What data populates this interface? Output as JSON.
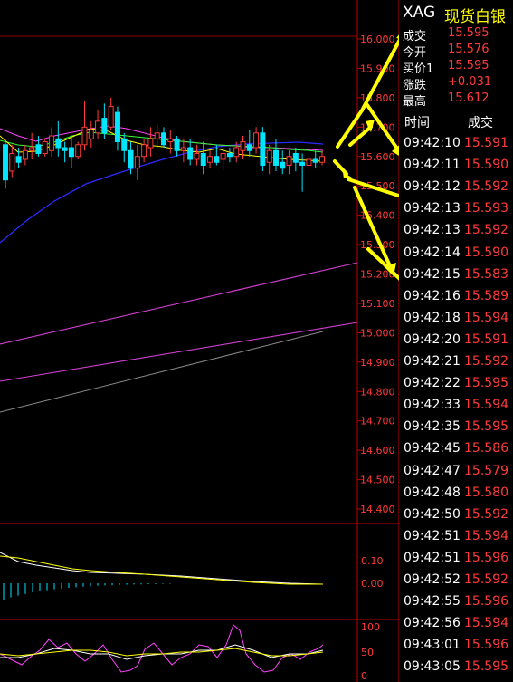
{
  "quote_header": {
    "symbol": "XAG",
    "name": "现货白银"
  },
  "quote_fields": [
    {
      "label": "成交",
      "value": "15.595"
    },
    {
      "label": "今开",
      "value": "15.576"
    },
    {
      "label": "买价1",
      "value": "15.595"
    },
    {
      "label": "涨跌",
      "value": "+0.031"
    },
    {
      "label": "最高",
      "value": "15.612"
    }
  ],
  "trade_table": {
    "headers": {
      "time": "时间",
      "price": "成交"
    },
    "rows": [
      {
        "time": "09:42:10",
        "price": "15.591"
      },
      {
        "time": "09:42:11",
        "price": "15.590"
      },
      {
        "time": "09:42:12",
        "price": "15.592"
      },
      {
        "time": "09:42:13",
        "price": "15.593"
      },
      {
        "time": "09:42:13",
        "price": "15.592"
      },
      {
        "time": "09:42:14",
        "price": "15.590"
      },
      {
        "time": "09:42:15",
        "price": "15.583"
      },
      {
        "time": "09:42:16",
        "price": "15.589"
      },
      {
        "time": "09:42:18",
        "price": "15.594"
      },
      {
        "time": "09:42:20",
        "price": "15.591"
      },
      {
        "time": "09:42:21",
        "price": "15.592"
      },
      {
        "time": "09:42:22",
        "price": "15.595"
      },
      {
        "time": "09:42:33",
        "price": "15.594"
      },
      {
        "time": "09:42:35",
        "price": "15.595"
      },
      {
        "time": "09:42:45",
        "price": "15.586"
      },
      {
        "time": "09:42:47",
        "price": "15.579"
      },
      {
        "time": "09:42:48",
        "price": "15.580"
      },
      {
        "time": "09:42:50",
        "price": "15.592"
      },
      {
        "time": "09:42:51",
        "price": "15.594"
      },
      {
        "time": "09:42:51",
        "price": "15.596"
      },
      {
        "time": "09:42:52",
        "price": "15.592"
      },
      {
        "time": "09:42:55",
        "price": "15.596"
      },
      {
        "time": "09:42:56",
        "price": "15.594"
      },
      {
        "time": "09:43:01",
        "price": "15.596"
      },
      {
        "time": "09:43:05",
        "price": "15.595"
      }
    ]
  },
  "chart_data": {
    "type": "candlestick",
    "price_axis": {
      "ylim": [
        14.35,
        16.05
      ],
      "ticks": [
        "16.000",
        "15.900",
        "15.800",
        "15.700",
        "15.600",
        "15.500",
        "15.400",
        "15.300",
        "15.200",
        "15.100",
        "15.000",
        "14.900",
        "14.800",
        "14.700",
        "14.600",
        "14.500",
        "14.400"
      ]
    },
    "candles": [
      {
        "o": 15.64,
        "h": 15.66,
        "l": 15.49,
        "c": 15.52
      },
      {
        "o": 15.55,
        "h": 15.64,
        "l": 15.53,
        "c": 15.61
      },
      {
        "o": 15.6,
        "h": 15.63,
        "l": 15.56,
        "c": 15.58
      },
      {
        "o": 15.59,
        "h": 15.64,
        "l": 15.57,
        "c": 15.62
      },
      {
        "o": 15.62,
        "h": 15.68,
        "l": 15.59,
        "c": 15.63
      },
      {
        "o": 15.64,
        "h": 15.67,
        "l": 15.6,
        "c": 15.61
      },
      {
        "o": 15.61,
        "h": 15.66,
        "l": 15.6,
        "c": 15.65
      },
      {
        "o": 15.62,
        "h": 15.7,
        "l": 15.6,
        "c": 15.67
      },
      {
        "o": 15.66,
        "h": 15.72,
        "l": 15.6,
        "c": 15.63
      },
      {
        "o": 15.63,
        "h": 15.65,
        "l": 15.58,
        "c": 15.62
      },
      {
        "o": 15.63,
        "h": 15.67,
        "l": 15.56,
        "c": 15.6
      },
      {
        "o": 15.6,
        "h": 15.65,
        "l": 15.59,
        "c": 15.64
      },
      {
        "o": 15.64,
        "h": 15.79,
        "l": 15.62,
        "c": 15.7
      },
      {
        "o": 15.66,
        "h": 15.72,
        "l": 15.63,
        "c": 15.69
      },
      {
        "o": 15.68,
        "h": 15.76,
        "l": 15.66,
        "c": 15.72
      },
      {
        "o": 15.73,
        "h": 15.78,
        "l": 15.66,
        "c": 15.68
      },
      {
        "o": 15.7,
        "h": 15.8,
        "l": 15.69,
        "c": 15.77
      },
      {
        "o": 15.75,
        "h": 15.77,
        "l": 15.62,
        "c": 15.65
      },
      {
        "o": 15.66,
        "h": 15.68,
        "l": 15.58,
        "c": 15.62
      },
      {
        "o": 15.62,
        "h": 15.65,
        "l": 15.54,
        "c": 15.56
      },
      {
        "o": 15.56,
        "h": 15.64,
        "l": 15.52,
        "c": 15.6
      },
      {
        "o": 15.6,
        "h": 15.66,
        "l": 15.58,
        "c": 15.64
      },
      {
        "o": 15.63,
        "h": 15.7,
        "l": 15.6,
        "c": 15.66
      },
      {
        "o": 15.66,
        "h": 15.71,
        "l": 15.63,
        "c": 15.68
      },
      {
        "o": 15.68,
        "h": 15.7,
        "l": 15.63,
        "c": 15.64
      },
      {
        "o": 15.65,
        "h": 15.69,
        "l": 15.61,
        "c": 15.66
      },
      {
        "o": 15.66,
        "h": 15.67,
        "l": 15.6,
        "c": 15.62
      },
      {
        "o": 15.62,
        "h": 15.66,
        "l": 15.58,
        "c": 15.63
      },
      {
        "o": 15.63,
        "h": 15.66,
        "l": 15.57,
        "c": 15.59
      },
      {
        "o": 15.59,
        "h": 15.64,
        "l": 15.57,
        "c": 15.61
      },
      {
        "o": 15.61,
        "h": 15.65,
        "l": 15.54,
        "c": 15.57
      },
      {
        "o": 15.58,
        "h": 15.62,
        "l": 15.56,
        "c": 15.6
      },
      {
        "o": 15.6,
        "h": 15.64,
        "l": 15.57,
        "c": 15.58
      },
      {
        "o": 15.59,
        "h": 15.63,
        "l": 15.55,
        "c": 15.61
      },
      {
        "o": 15.61,
        "h": 15.63,
        "l": 15.58,
        "c": 15.6
      },
      {
        "o": 15.6,
        "h": 15.65,
        "l": 15.58,
        "c": 15.63
      },
      {
        "o": 15.62,
        "h": 15.67,
        "l": 15.59,
        "c": 15.65
      },
      {
        "o": 15.64,
        "h": 15.69,
        "l": 15.6,
        "c": 15.62
      },
      {
        "o": 15.63,
        "h": 15.7,
        "l": 15.61,
        "c": 15.68
      },
      {
        "o": 15.68,
        "h": 15.7,
        "l": 15.55,
        "c": 15.57
      },
      {
        "o": 15.58,
        "h": 15.64,
        "l": 15.54,
        "c": 15.62
      },
      {
        "o": 15.62,
        "h": 15.66,
        "l": 15.55,
        "c": 15.57
      },
      {
        "o": 15.58,
        "h": 15.62,
        "l": 15.54,
        "c": 15.56
      },
      {
        "o": 15.57,
        "h": 15.62,
        "l": 15.54,
        "c": 15.6
      },
      {
        "o": 15.61,
        "h": 15.63,
        "l": 15.55,
        "c": 15.58
      },
      {
        "o": 15.58,
        "h": 15.61,
        "l": 15.48,
        "c": 15.57
      },
      {
        "o": 15.57,
        "h": 15.6,
        "l": 15.55,
        "c": 15.59
      },
      {
        "o": 15.59,
        "h": 15.62,
        "l": 15.56,
        "c": 15.58
      },
      {
        "o": 15.58,
        "h": 15.62,
        "l": 15.57,
        "c": 15.6
      }
    ],
    "macd_axis": {
      "ticks": [
        "0.10",
        "0.00"
      ]
    },
    "oscillator_axis": {
      "ticks": [
        "100",
        "50",
        "0"
      ]
    }
  },
  "colors": {
    "up": "#ff3b3b",
    "down": "#00e5ff",
    "ma_blue": "#2a2aff",
    "ma_magenta": "#ff44ff",
    "ma_yellow": "#ffff00",
    "ma_green": "#33ff33",
    "arrow": "#ffff00",
    "frame": "#c00000"
  }
}
